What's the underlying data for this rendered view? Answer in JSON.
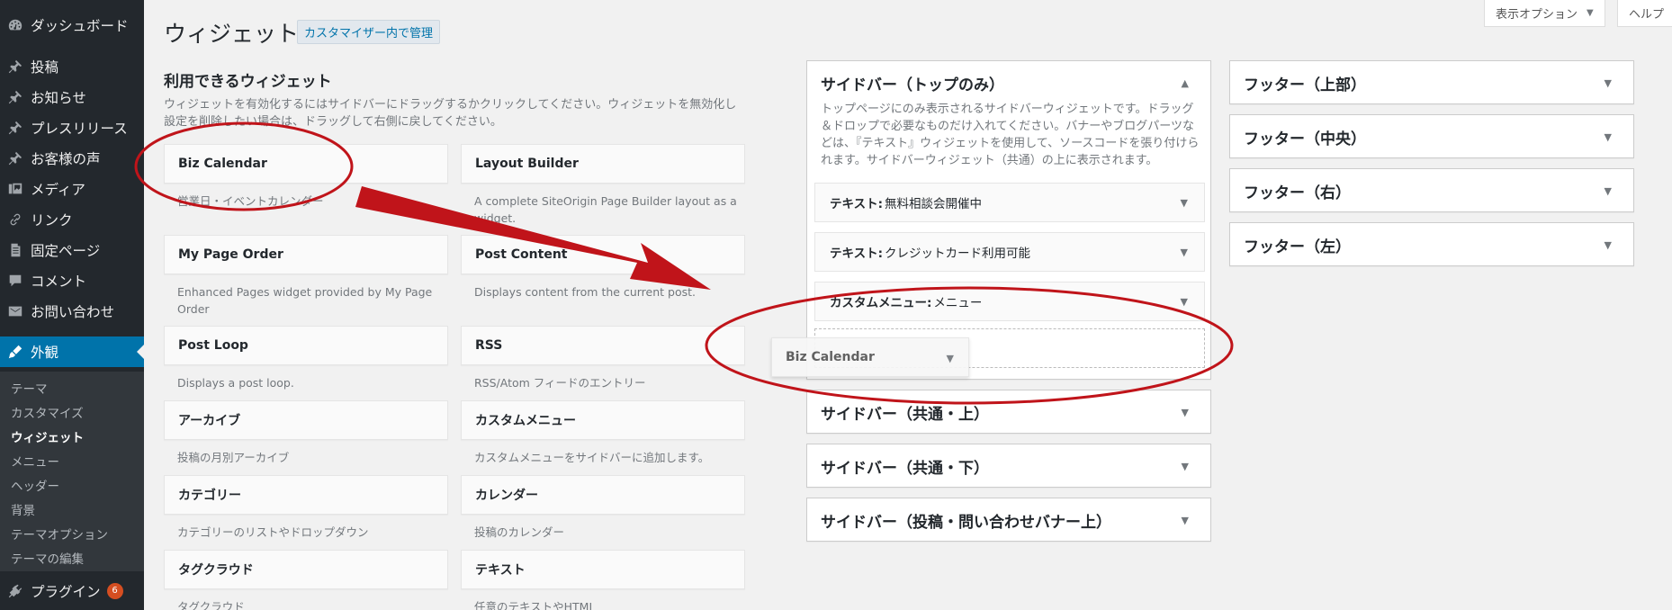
{
  "admin_menu": {
    "dashboard": "ダッシュボード",
    "posts": "投稿",
    "news": "お知らせ",
    "press": "プレスリリース",
    "voice": "お客様の声",
    "media": "メディア",
    "links": "リンク",
    "pages": "固定ページ",
    "comments": "コメント",
    "contact": "お問い合わせ",
    "appearance": "外観",
    "submenu": [
      "テーマ",
      "カスタマイズ",
      "ウィジェット",
      "メニュー",
      "ヘッダー",
      "背景",
      "テーマオプション",
      "テーマの編集"
    ],
    "plugins": "プラグイン",
    "plugins_badge": "6"
  },
  "screen_meta": {
    "options": "表示オプション",
    "help": "ヘルプ"
  },
  "page": {
    "title": "ウィジェット",
    "action": "カスタマイザー内で管理"
  },
  "available": {
    "title": "利用できるウィジェット",
    "description": "ウィジェットを有効化するにはサイドバーにドラッグするかクリックしてください。ウィジェットを無効化し設定を削除したい場合は、ドラッグして右側に戻してください。",
    "widgets": [
      {
        "title": "Biz Calendar",
        "desc": "営業日・イベントカレンダー"
      },
      {
        "title": "Layout Builder",
        "desc": "A complete SiteOrigin Page Builder layout as a widget."
      },
      {
        "title": "My Page Order",
        "desc": "Enhanced Pages widget provided by My Page Order"
      },
      {
        "title": "Post Content",
        "desc": "Displays content from the current post."
      },
      {
        "title": "Post Loop",
        "desc": "Displays a post loop."
      },
      {
        "title": "RSS",
        "desc": "RSS/Atom フィードのエントリー"
      },
      {
        "title": "アーカイブ",
        "desc": "投稿の月別アーカイブ"
      },
      {
        "title": "カスタムメニュー",
        "desc": "カスタムメニューをサイドバーに追加します。"
      },
      {
        "title": "カテゴリー",
        "desc": "カテゴリーのリストやドロップダウン"
      },
      {
        "title": "カレンダー",
        "desc": "投稿のカレンダー"
      },
      {
        "title": "タグクラウド",
        "desc": "タグクラウド"
      },
      {
        "title": "テキスト",
        "desc": "任意のテキストやHTML"
      }
    ]
  },
  "sidebar_top": {
    "title": "サイドバー（トップのみ）",
    "description": "トップページにのみ表示されるサイドバーウィジェットです。ドラッグ＆ドロップで必要なものだけ入れてください。バナーやブログパーツなどは、『テキスト』ウィジェットを使用して、ソースコードを張り付けられます。サイドバーウィジェット（共通）の上に表示されます。",
    "widgets": [
      {
        "type": "テキスト:",
        "title": "無料相談会開催中"
      },
      {
        "type": "テキスト:",
        "title": "クレジットカード利用可能"
      },
      {
        "type": "カスタムメニュー:",
        "title": "メニュー"
      }
    ]
  },
  "dragging_widget": "Biz Calendar",
  "sidebars_middle": [
    "サイドバー（共通・上）",
    "サイドバー（共通・下）",
    "サイドバー（投稿・問い合わせバナー上）"
  ],
  "sidebars_right": [
    "フッター（上部）",
    "フッター（中央）",
    "フッター（右）",
    "フッター（左）"
  ],
  "colors": {
    "admin_bg": "#23282d",
    "accent": "#0073aa",
    "annotation": "#c0141a"
  }
}
